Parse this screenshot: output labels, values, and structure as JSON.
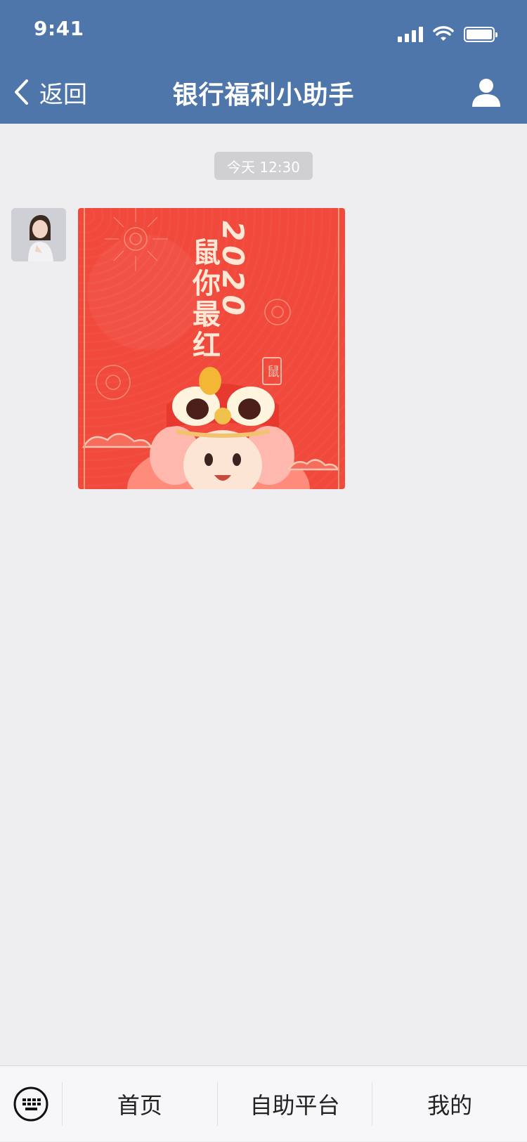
{
  "status": {
    "time": "9:41"
  },
  "nav": {
    "back_label": "返回",
    "title": "银行福利小助手"
  },
  "chat": {
    "timestamp": "今天 12:30",
    "card": {
      "year_text": "2020",
      "phrase_text": "鼠你最红",
      "seal_text": "鼠"
    }
  },
  "bottom": {
    "tabs": [
      {
        "label": "首页"
      },
      {
        "label": "自助平台"
      },
      {
        "label": "我的"
      }
    ]
  },
  "colors": {
    "header_bg": "#4f76aa",
    "background": "#eeedef",
    "card_red": "#f1493c",
    "timestamp_bg": "#d0cfd2"
  }
}
